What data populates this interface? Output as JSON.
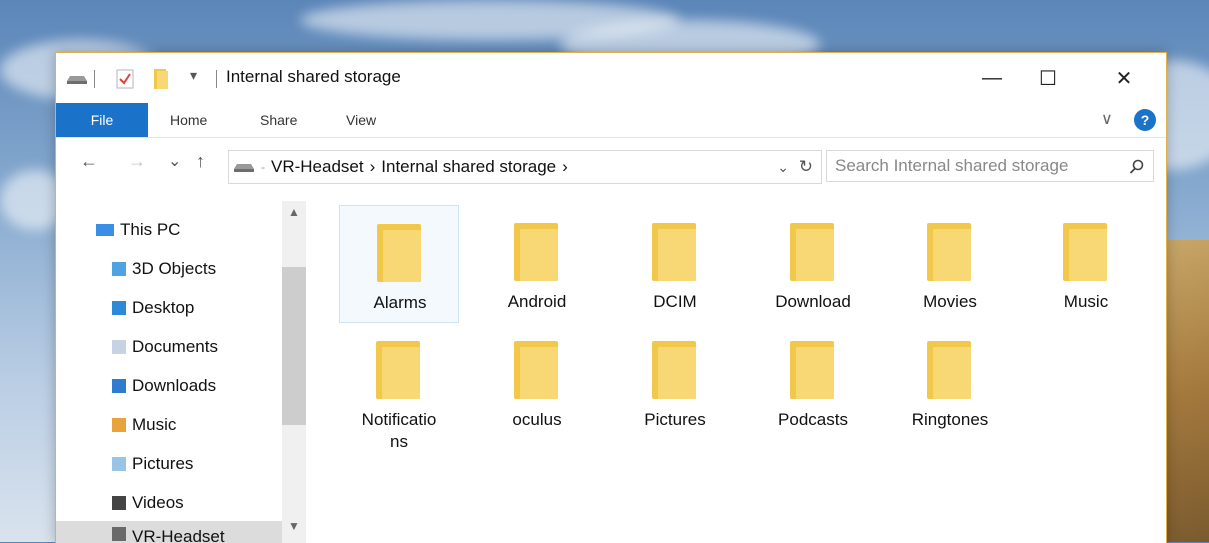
{
  "window": {
    "title": "Internal shared storage",
    "controls": {
      "minimize": "—",
      "maximize": "☐",
      "close": "✕"
    }
  },
  "ribbon": {
    "tabs": [
      "File",
      "Home",
      "Share",
      "View"
    ],
    "help": "?",
    "expand": "∨"
  },
  "navbar": {
    "back": "←",
    "forward": "→",
    "recent": "⌄",
    "up": "↑",
    "breadcrumb": [
      "VR-Headset",
      "Internal shared storage"
    ],
    "separator": "›",
    "refresh": "↻",
    "search_placeholder": "Search Internal shared storage"
  },
  "sidebar": {
    "items": [
      {
        "label": "This PC",
        "icon": "this-pc-icon",
        "color": "#3a8ee6"
      },
      {
        "label": "3D Objects",
        "icon": "3d-objects-icon",
        "color": "#4fa3e0"
      },
      {
        "label": "Desktop",
        "icon": "desktop-icon",
        "color": "#2e8ad8"
      },
      {
        "label": "Documents",
        "icon": "documents-icon",
        "color": "#8aa4c0"
      },
      {
        "label": "Downloads",
        "icon": "downloads-icon",
        "color": "#2e7bd0"
      },
      {
        "label": "Music",
        "icon": "music-icon",
        "color": "#e9a33b"
      },
      {
        "label": "Pictures",
        "icon": "pictures-icon",
        "color": "#7ab4e2"
      },
      {
        "label": "Videos",
        "icon": "videos-icon",
        "color": "#444444"
      },
      {
        "label": "VR-Headset",
        "icon": "vr-headset-icon",
        "color": "#6a6a6a"
      }
    ]
  },
  "folders": [
    {
      "name": "Alarms"
    },
    {
      "name": "Android"
    },
    {
      "name": "DCIM"
    },
    {
      "name": "Download"
    },
    {
      "name": "Movies"
    },
    {
      "name": "Music"
    },
    {
      "name": "Notifications"
    },
    {
      "name": "oculus"
    },
    {
      "name": "Pictures"
    },
    {
      "name": "Podcasts"
    },
    {
      "name": "Ringtones"
    }
  ],
  "colors": {
    "accent": "#1a73c8",
    "folder_back": "#f2c84b",
    "folder_front": "#f8d775",
    "window_border": "#e0b04a"
  }
}
